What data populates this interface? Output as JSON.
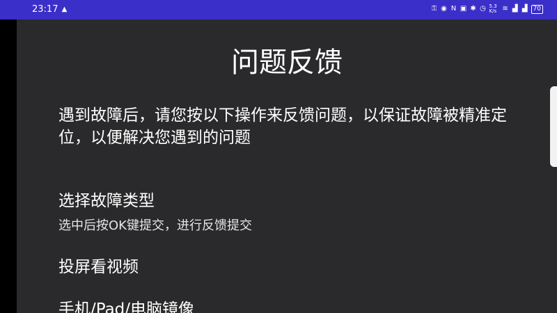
{
  "status_bar": {
    "time": "23:17",
    "battery": "70",
    "network_speed": "5.3 K/s",
    "bg_color": "#3b2fc9"
  },
  "page": {
    "title": "问题反馈",
    "description": "遇到故障后，请您按以下操作来反馈问题，以保证故障被精准定位，以便解决您遇到的问题",
    "section": {
      "title": "选择故障类型",
      "hint": "选中后按OK键提交，进行反馈提交"
    },
    "options": [
      {
        "label": "投屏看视频"
      },
      {
        "label": "手机/Pad/电脑镜像"
      }
    ],
    "bg_color": "#2a2a2c"
  }
}
